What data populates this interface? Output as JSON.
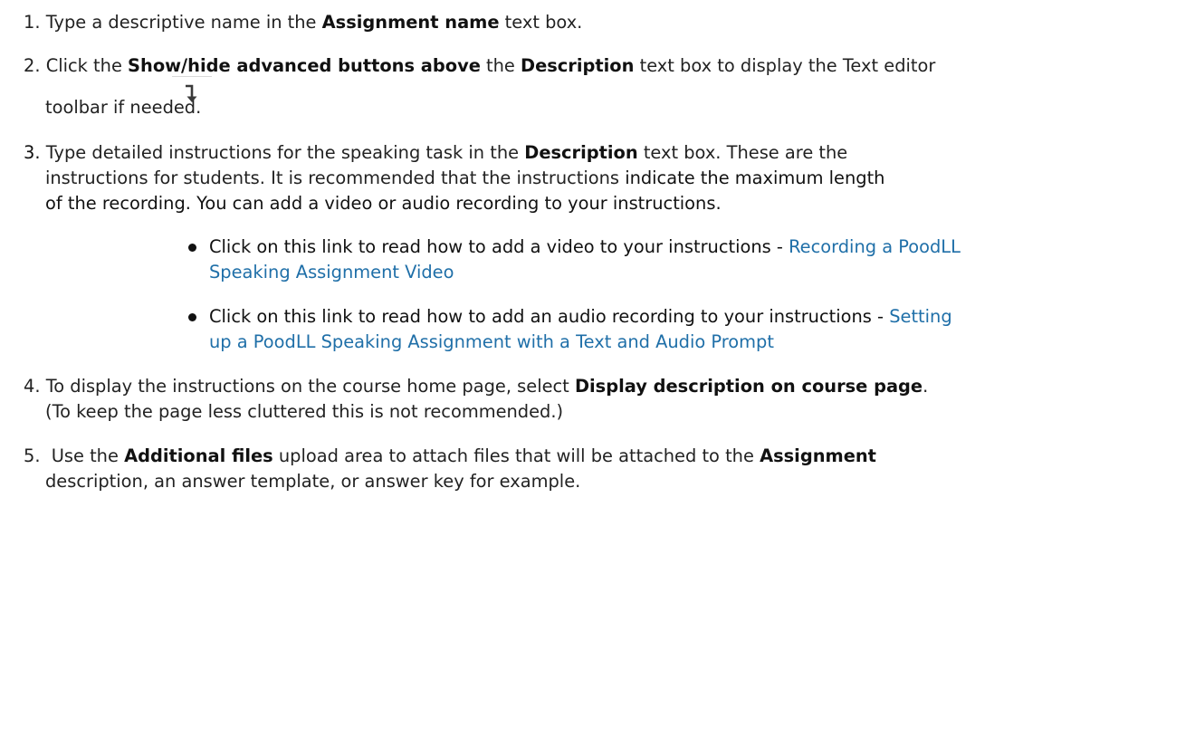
{
  "steps": {
    "s1": {
      "num": "1.",
      "t1": "Type a descriptive name in the ",
      "b1": "Assignment name",
      "t2": " text box."
    },
    "s2": {
      "num": "2.",
      "t1": "Click the ",
      "b1": "Show/hide advanced buttons above",
      "t2": " the ",
      "b2": "Description",
      "t3": " text box to display the Text editor",
      "line2": "toolbar if needed."
    },
    "s3": {
      "num": "3.",
      "line1a": "Type detailed instructions for the speaking task in the ",
      "line1b": "Description",
      "line1c": " text box. These are the",
      "line2a": "instructions for students. It is recommended that the instructions ",
      "line2b": "indicate the maximum length",
      "line3": "of the recording. You can add a video or audio recording to your instructions."
    },
    "bullets": [
      {
        "text": "Click on this link to read how to add a video to your instructions - ",
        "link1": "Recording a PoodLL",
        "link2": "Speaking Assignment Video"
      },
      {
        "text": "Click on this link to read how to add an audio recording to your instructions - ",
        "link1": "Setting",
        "link2": "up a PoodLL Speaking Assignment with a Text and Audio Prompt"
      }
    ],
    "s4": {
      "num": "4.",
      "t1": "To display the instructions on the course home page, select ",
      "b1": "Display description on course page",
      "t2": ".",
      "line2": "(To keep the page less cluttered this is not recommended.)"
    },
    "s5": {
      "num": "5.",
      "t1": "Use the ",
      "b1": "Additional files",
      "t2": " upload area to attach files that will be attached to the ",
      "b2": "Assignment",
      "line2": "description, an answer template, or answer key for example."
    }
  },
  "colors": {
    "link": "#1f6fa8",
    "text": "#222222"
  },
  "icons": {
    "toolbar_toggle": "arrow-down-icon"
  }
}
